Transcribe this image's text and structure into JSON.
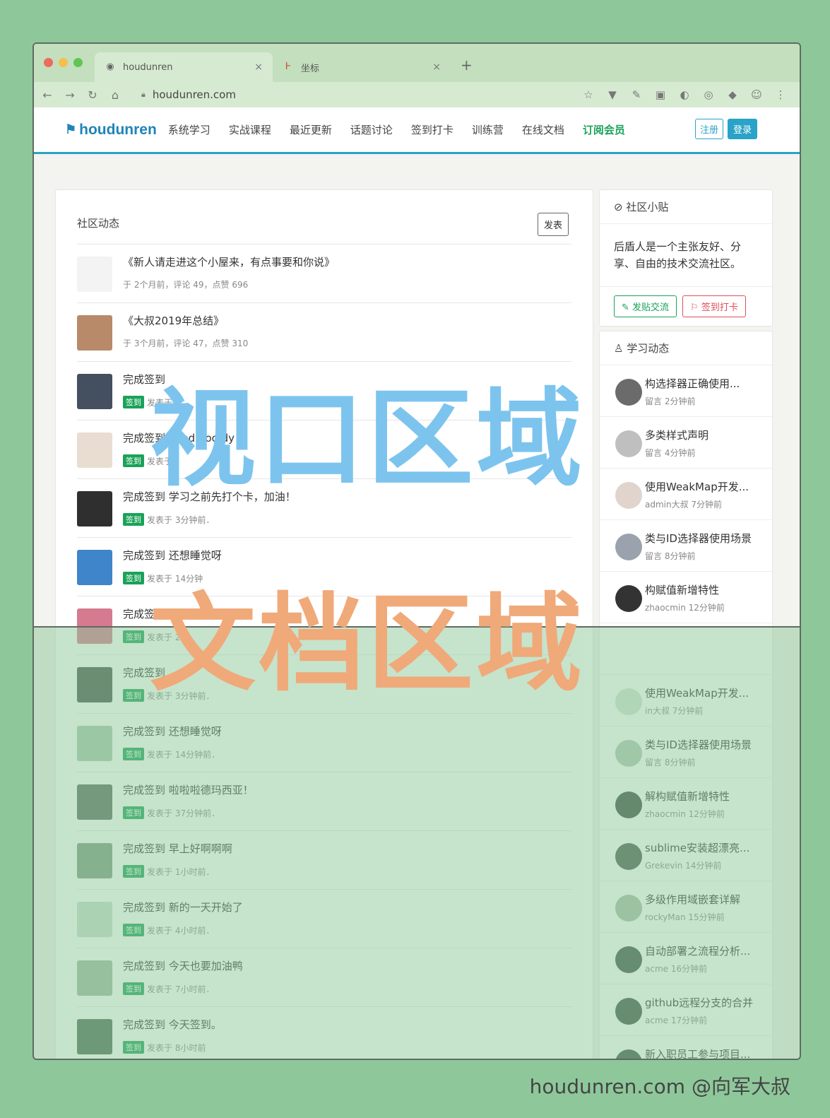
{
  "browser": {
    "tabs": [
      {
        "label": "houdunren",
        "close": "×"
      },
      {
        "label": "坐标",
        "close": "×"
      }
    ],
    "new_tab": "+",
    "url": "houdunren.com",
    "nav_icons": [
      "back-icon",
      "forward-icon",
      "reload-icon",
      "home-icon"
    ]
  },
  "site": {
    "logo": "houdunren",
    "nav": [
      "系统学习",
      "实战课程",
      "最近更新",
      "话题讨论",
      "签到打卡",
      "训练营",
      "在线文档",
      "订阅会员"
    ],
    "register": "注册",
    "login": "登录"
  },
  "feed": {
    "title": "社区动态",
    "post_button": "发表",
    "items": [
      {
        "title": "《新人请走进这个小屋来，有点事要和你说》",
        "meta": "于 2个月前，评论 49，点赞 696",
        "badge": "",
        "avatar_color": "#f3f3f3"
      },
      {
        "title": "《大叔2019年总结》",
        "meta": "于 3个月前，评论 47，点赞 310",
        "badge": "",
        "avatar_color": "#b88a6a"
      },
      {
        "title": "完成签到",
        "meta": "发表于",
        "badge": "签到",
        "avatar_color": "#445060"
      },
      {
        "title": "完成签到 good goo dy",
        "meta": "发表于",
        "badge": "签到",
        "avatar_color": "#e9ddd2"
      },
      {
        "title": "完成签到 学习之前先打个卡，加油！",
        "meta": "发表于 3分钟前．",
        "badge": "签到",
        "avatar_color": "#2f2f2f"
      },
      {
        "title": "完成签到 还想睡觉呀",
        "meta": "发表于 14分钟",
        "badge": "签到",
        "avatar_color": "#3f85c9"
      },
      {
        "title": "完成签到 啦啦",
        "meta": "发表于 2分",
        "badge": "签到",
        "avatar_color": "#d57a8f"
      },
      {
        "title": "完成签到",
        "meta": "发表于 3分钟前．",
        "badge": "签到",
        "avatar_color": "#48524a"
      },
      {
        "title": "完成签到 还想睡觉呀",
        "meta": "发表于 14分钟前．",
        "badge": "签到",
        "avatar_color": "#a9c7b0"
      },
      {
        "title": "完成签到 啦啦啦德玛西亚！",
        "meta": "发表于 37分钟前．",
        "badge": "签到",
        "avatar_color": "#5a6a5e"
      },
      {
        "title": "完成签到 早上好啊啊啊",
        "meta": "发表于 1小时前．",
        "badge": "签到",
        "avatar_color": "#7f9a85"
      },
      {
        "title": "完成签到 新的一天开始了",
        "meta": "发表于 4小时前．",
        "badge": "签到",
        "avatar_color": "#c9ddcd"
      },
      {
        "title": "完成签到 今天也要加油鸭",
        "meta": "发表于 7小时前．",
        "badge": "签到",
        "avatar_color": "#9fb8a2"
      },
      {
        "title": "完成签到 今天签到。",
        "meta": "发表于 8小时前",
        "badge": "签到",
        "avatar_color": "#4f6a58"
      }
    ]
  },
  "tips": {
    "title": "社区小贴",
    "text": "后盾人是一个主张友好、分享、自由的技术交流社区。",
    "post_btn": "发贴交流",
    "checkin_btn": "签到打卡"
  },
  "learning": {
    "title": "学习动态",
    "items": [
      {
        "title": "构选择器正确使用...",
        "meta": "留言 2分钟前",
        "avatar_color": "#6b6b6b"
      },
      {
        "title": "多类样式声明",
        "meta": "留言 4分钟前",
        "avatar_color": "#bfbfbf"
      },
      {
        "title": "使用WeakMap开发...",
        "meta": "admin大叔 7分钟前",
        "avatar_color": "#e0d4cc"
      },
      {
        "title": "类与ID选择器使用场景",
        "meta": "留言 8分钟前",
        "avatar_color": "#9aa3ad"
      },
      {
        "title": "构赋值新增特性",
        "meta": "zhaocmin 12分钟前",
        "avatar_color": "#333333"
      },
      {
        "title": "",
        "meta": "",
        "avatar_color": "#ffffff"
      },
      {
        "title": "使用WeakMap开发...",
        "meta": "in大叔 7分钟前",
        "avatar_color": "#d5e3d5"
      },
      {
        "title": "类与ID选择器使用场景",
        "meta": "留言 8分钟前",
        "avatar_color": "#b2c7b6"
      },
      {
        "title": "解构赋值新增特性",
        "meta": "zhaocmin 12分钟前",
        "avatar_color": "#3b4b40"
      },
      {
        "title": "sublime安装超漂亮...",
        "meta": "Grekevin 14分钟前",
        "avatar_color": "#4a5a4e"
      },
      {
        "title": "多级作用域嵌套详解",
        "meta": "rockyMan 15分钟前",
        "avatar_color": "#a8bda8"
      },
      {
        "title": "自动部署之流程分析...",
        "meta": "acme 16分钟前",
        "avatar_color": "#3f5346"
      },
      {
        "title": "github远程分支的合并",
        "meta": "acme 17分钟前",
        "avatar_color": "#3f5346"
      },
      {
        "title": "新入职员工参与项目...",
        "meta": "acme 20分钟前",
        "avatar_color": "#3f5346"
      }
    ]
  },
  "overlay": {
    "viewport_label": "视口区域",
    "document_label": "文档区域"
  },
  "credit": "houdunren.com @向军大叔",
  "colors": {
    "background": "#8ec89a",
    "brand": "#1e84b8",
    "accent": "#29a3c7",
    "green": "#1aa259",
    "red": "#e24f59",
    "viewport_label": "#7cc4ee",
    "document_label": "#f0a979"
  }
}
